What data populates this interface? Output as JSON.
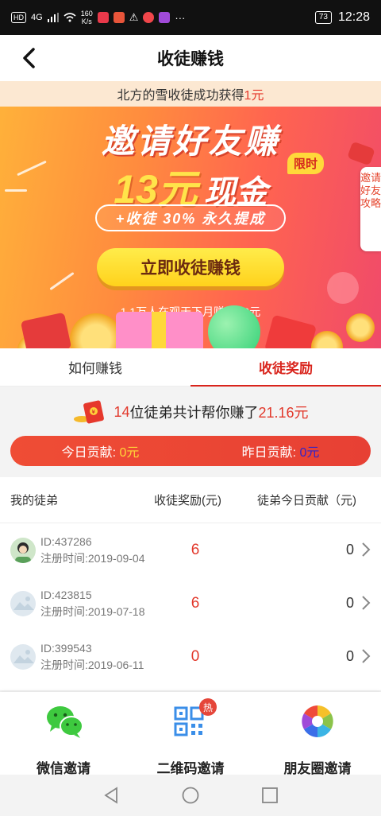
{
  "status_bar": {
    "network": "HD",
    "signal": "4G",
    "speed": "160\nK/s",
    "battery": "73",
    "time": "12:28",
    "more": "···"
  },
  "header": {
    "title": "收徒赚钱"
  },
  "banner": {
    "notice_prefix": "北方的雪收徒成功获得",
    "notice_amount": "1元",
    "title": "邀请好友赚",
    "cash_amount": "13元",
    "cash_text": "现金",
    "limit_badge": "限时",
    "subtitle": "+收徒 30% 永久提成",
    "cta": "立即收徒赚钱",
    "stat": "1.1万人在观天下月赚4000元",
    "guide_tab": "邀请好友攻略"
  },
  "tabs": [
    {
      "label": "如何赚钱",
      "active": false
    },
    {
      "label": "收徒奖励",
      "active": true
    }
  ],
  "summary": {
    "count": "14",
    "text_mid": "位徒弟共计帮你赚了",
    "total": "21.16元",
    "today_label": "今日贡献:",
    "today_value": "0元",
    "yesterday_label": "昨日贡献:",
    "yesterday_value": "0元"
  },
  "table": {
    "headers": [
      "我的徒弟",
      "收徒奖励(元)",
      "徒弟今日贡献（元)"
    ],
    "rows": [
      {
        "id": "ID:437286",
        "reg": "注册时间:2019-09-04",
        "reward": "6",
        "today": "0"
      },
      {
        "id": "ID:423815",
        "reg": "注册时间:2019-07-18",
        "reward": "6",
        "today": "0"
      },
      {
        "id": "ID:399543",
        "reg": "注册时间:2019-06-11",
        "reward": "0",
        "today": "0"
      }
    ]
  },
  "share": {
    "wechat": "微信邀请",
    "qrcode": "二维码邀请",
    "moments": "朋友圈邀请",
    "hot": "热"
  },
  "colors": {
    "accent_red": "#d9241c",
    "banner_orange": "#ff8c3e",
    "cta_yellow": "#ffd21c",
    "wechat_green": "#3ec93f",
    "qr_blue": "#3a8ee8"
  },
  "icons": {
    "back": "back-arrow-icon",
    "chevron": "chevron-right-icon",
    "wechat": "wechat-icon",
    "qrcode": "qrcode-icon",
    "moments": "moments-aperture-icon",
    "nav_back": "triangle-back-icon",
    "nav_home": "circle-home-icon",
    "nav_recent": "square-recent-icon"
  }
}
